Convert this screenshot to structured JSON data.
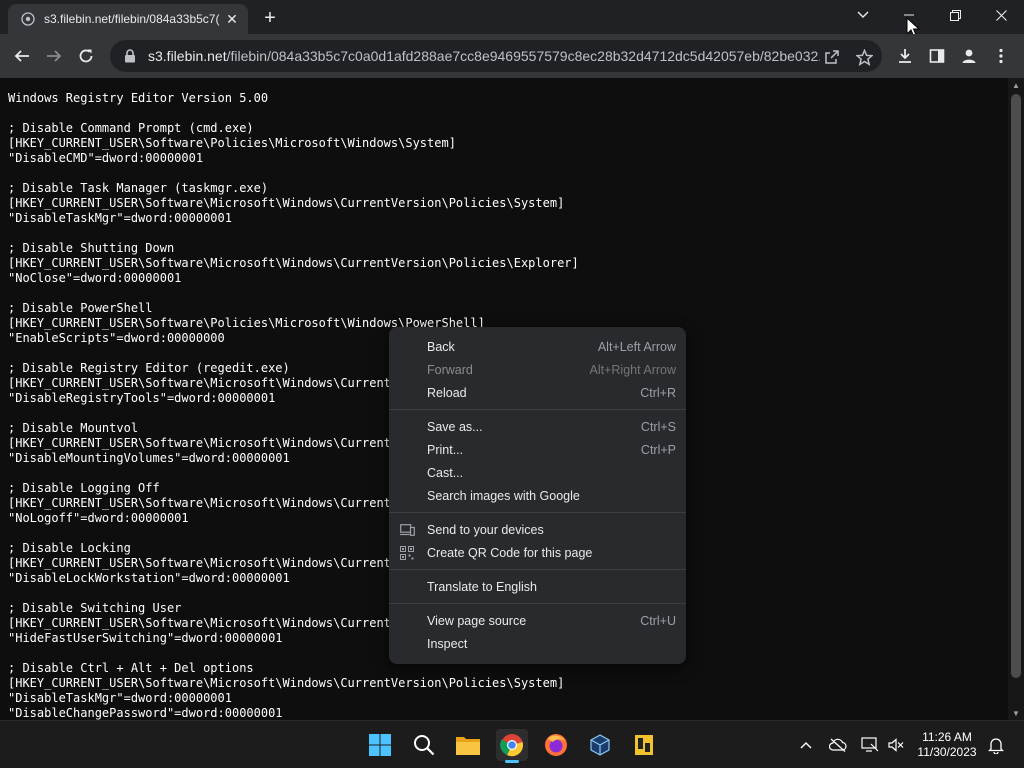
{
  "browser": {
    "tab": {
      "title": "s3.filebin.net/filebin/084a33b5c7("
    },
    "url": {
      "host": "s3.filebin.net",
      "path": "/filebin/084a33b5c7c0a0d1afd288ae7cc8e9469557579c8ec28b32d4712dc5d42057eb/82be032..."
    }
  },
  "page": {
    "lines": [
      "Windows Registry Editor Version 5.00",
      "",
      "; Disable Command Prompt (cmd.exe)",
      "[HKEY_CURRENT_USER\\Software\\Policies\\Microsoft\\Windows\\System]",
      "\"DisableCMD\"=dword:00000001",
      "",
      "; Disable Task Manager (taskmgr.exe)",
      "[HKEY_CURRENT_USER\\Software\\Microsoft\\Windows\\CurrentVersion\\Policies\\System]",
      "\"DisableTaskMgr\"=dword:00000001",
      "",
      "; Disable Shutting Down",
      "[HKEY_CURRENT_USER\\Software\\Microsoft\\Windows\\CurrentVersion\\Policies\\Explorer]",
      "\"NoClose\"=dword:00000001",
      "",
      "; Disable PowerShell",
      "[HKEY_CURRENT_USER\\Software\\Policies\\Microsoft\\Windows\\PowerShell]",
      "\"EnableScripts\"=dword:00000000",
      "",
      "; Disable Registry Editor (regedit.exe)",
      "[HKEY_CURRENT_USER\\Software\\Microsoft\\Windows\\CurrentV",
      "\"DisableRegistryTools\"=dword:00000001",
      "",
      "; Disable Mountvol",
      "[HKEY_CURRENT_USER\\Software\\Microsoft\\Windows\\CurrentV",
      "\"DisableMountingVolumes\"=dword:00000001",
      "",
      "; Disable Logging Off",
      "[HKEY_CURRENT_USER\\Software\\Microsoft\\Windows\\CurrentV",
      "\"NoLogoff\"=dword:00000001",
      "",
      "; Disable Locking",
      "[HKEY_CURRENT_USER\\Software\\Microsoft\\Windows\\CurrentV",
      "\"DisableLockWorkstation\"=dword:00000001",
      "",
      "; Disable Switching User",
      "[HKEY_CURRENT_USER\\Software\\Microsoft\\Windows\\CurrentV",
      "\"HideFastUserSwitching\"=dword:00000001",
      "",
      "; Disable Ctrl + Alt + Del options",
      "[HKEY_CURRENT_USER\\Software\\Microsoft\\Windows\\CurrentVersion\\Policies\\System]",
      "\"DisableTaskMgr\"=dword:00000001",
      "\"DisableChangePassword\"=dword:00000001"
    ]
  },
  "context_menu": {
    "back": {
      "label": "Back",
      "shortcut": "Alt+Left Arrow"
    },
    "forward": {
      "label": "Forward",
      "shortcut": "Alt+Right Arrow"
    },
    "reload": {
      "label": "Reload",
      "shortcut": "Ctrl+R"
    },
    "save_as": {
      "label": "Save as...",
      "shortcut": "Ctrl+S"
    },
    "print": {
      "label": "Print...",
      "shortcut": "Ctrl+P"
    },
    "cast": {
      "label": "Cast..."
    },
    "search_images": {
      "label": "Search images with Google"
    },
    "send_devices": {
      "label": "Send to your devices"
    },
    "qr_code": {
      "label": "Create QR Code for this page"
    },
    "translate": {
      "label": "Translate to English"
    },
    "view_source": {
      "label": "View page source",
      "shortcut": "Ctrl+U"
    },
    "inspect": {
      "label": "Inspect"
    }
  },
  "taskbar": {
    "clock": {
      "time": "11:26 AM",
      "date": "11/30/2023"
    },
    "icons": [
      "windows-start-icon",
      "search-icon",
      "file-explorer-icon",
      "chrome-icon",
      "firefox-icon",
      "virtualbox-icon",
      "app-icon"
    ]
  },
  "colors": {
    "page_background": "#0e0e0e",
    "page_text": "#ffffff",
    "menu_background": "#292a2d",
    "accent": "#4cc2ff"
  }
}
